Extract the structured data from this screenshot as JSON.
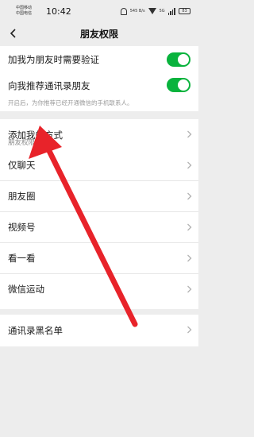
{
  "status_bar": {
    "carrier_line1": "中国移动",
    "carrier_line2": "中国电信",
    "time": "10:42",
    "speed": "545 B/s",
    "network": "5G",
    "battery": "83"
  },
  "header": {
    "title": "朋友权限"
  },
  "verification": {
    "items": [
      {
        "label": "加我为朋友时需要验证",
        "toggle_on": true
      },
      {
        "label": "向我推荐通讯录朋友",
        "toggle_on": true
      }
    ],
    "hint": "开启后，为你推荐已经开通微信的手机联系人。"
  },
  "add_methods": {
    "label": "添加我的方式"
  },
  "friend_permissions": {
    "section_label": "朋友权限",
    "items": [
      {
        "label": "仅聊天"
      },
      {
        "label": "朋友圈"
      },
      {
        "label": "视频号"
      },
      {
        "label": "看一看"
      },
      {
        "label": "微信运动"
      }
    ]
  },
  "blacklist": {
    "label": "通讯录黑名单"
  },
  "colors": {
    "toggle_on": "#09b33d",
    "annotation_arrow": "#e8232a",
    "background": "#ededed"
  }
}
